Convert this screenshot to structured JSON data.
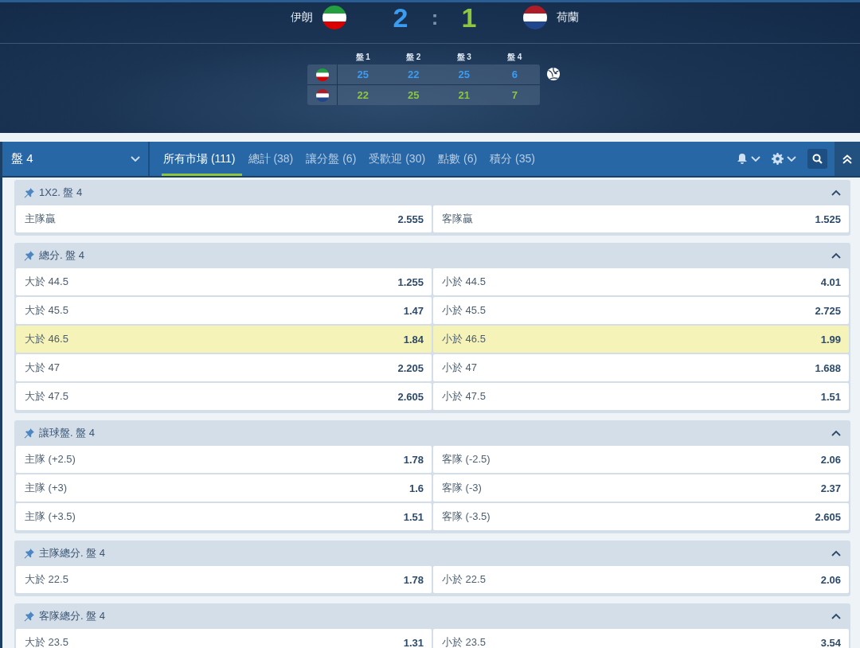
{
  "match": {
    "teams": [
      {
        "name": "伊朗",
        "kind": "iran",
        "color": "#3b9cf0",
        "score": "2",
        "serving": true,
        "sets": [
          "25",
          "22",
          "25",
          "6"
        ]
      },
      {
        "name": "荷蘭",
        "kind": "netherlands",
        "color": "#8dc63f",
        "score": "1",
        "serving": false,
        "sets": [
          "22",
          "25",
          "21",
          "7"
        ]
      }
    ],
    "separator": ":",
    "set_headers": [
      "盤 1",
      "盤 2",
      "盤 3",
      "盤 4"
    ]
  },
  "nav": {
    "period": "盤 4",
    "tabs": [
      {
        "label": "所有市場 (111)",
        "selected": true
      },
      {
        "label": "總計 (38)",
        "selected": false
      },
      {
        "label": "讓分盤 (6)",
        "selected": false
      },
      {
        "label": "受歡迎 (30)",
        "selected": false
      },
      {
        "label": "點數 (6)",
        "selected": false
      },
      {
        "label": "積分 (35)",
        "selected": false
      }
    ]
  },
  "markets": [
    {
      "title": "1X2. 盤 4",
      "expanded": true,
      "rows": [
        {
          "highlighted": false,
          "options": [
            {
              "label": "主隊贏",
              "odds": "2.555"
            },
            {
              "label": "客隊贏",
              "odds": "1.525"
            }
          ]
        }
      ]
    },
    {
      "title": "總分. 盤 4",
      "expanded": true,
      "rows": [
        {
          "highlighted": false,
          "options": [
            {
              "label": "大於 44.5",
              "odds": "1.255"
            },
            {
              "label": "小於 44.5",
              "odds": "4.01"
            }
          ]
        },
        {
          "highlighted": false,
          "options": [
            {
              "label": "大於 45.5",
              "odds": "1.47"
            },
            {
              "label": "小於 45.5",
              "odds": "2.725"
            }
          ]
        },
        {
          "highlighted": true,
          "options": [
            {
              "label": "大於 46.5",
              "odds": "1.84"
            },
            {
              "label": "小於 46.5",
              "odds": "1.99"
            }
          ]
        },
        {
          "highlighted": false,
          "options": [
            {
              "label": "大於 47",
              "odds": "2.205"
            },
            {
              "label": "小於 47",
              "odds": "1.688"
            }
          ]
        },
        {
          "highlighted": false,
          "options": [
            {
              "label": "大於 47.5",
              "odds": "2.605"
            },
            {
              "label": "小於 47.5",
              "odds": "1.51"
            }
          ]
        }
      ]
    },
    {
      "title": "讓球盤. 盤 4",
      "expanded": true,
      "rows": [
        {
          "highlighted": false,
          "options": [
            {
              "label": "主隊 (+2.5)",
              "odds": "1.78"
            },
            {
              "label": "客隊 (-2.5)",
              "odds": "2.06"
            }
          ]
        },
        {
          "highlighted": false,
          "options": [
            {
              "label": "主隊 (+3)",
              "odds": "1.6"
            },
            {
              "label": "客隊 (-3)",
              "odds": "2.37"
            }
          ]
        },
        {
          "highlighted": false,
          "options": [
            {
              "label": "主隊 (+3.5)",
              "odds": "1.51"
            },
            {
              "label": "客隊 (-3.5)",
              "odds": "2.605"
            }
          ]
        }
      ]
    },
    {
      "title": "主隊總分. 盤 4",
      "expanded": true,
      "rows": [
        {
          "highlighted": false,
          "options": [
            {
              "label": "大於 22.5",
              "odds": "1.78"
            },
            {
              "label": "小於 22.5",
              "odds": "2.06"
            }
          ]
        }
      ]
    },
    {
      "title": "客隊總分. 盤 4",
      "expanded": true,
      "rows": [
        {
          "highlighted": false,
          "options": [
            {
              "label": "大於 23.5",
              "odds": "1.31"
            },
            {
              "label": "小於 23.5",
              "odds": "3.54"
            }
          ]
        }
      ]
    }
  ]
}
